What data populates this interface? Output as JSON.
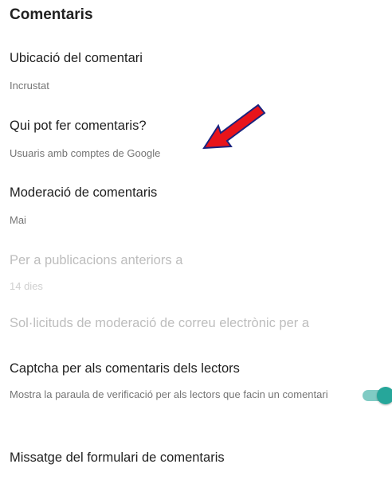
{
  "section_title": "Comentaris",
  "settings": {
    "location": {
      "title": "Ubicació del comentari",
      "value": "Incrustat"
    },
    "who_can_comment": {
      "title": "Qui pot fer comentaris?",
      "value": "Usuaris amb comptes de Google"
    },
    "moderation": {
      "title": "Moderació de comentaris",
      "value": "Mai"
    },
    "older_posts": {
      "title": "Per a publicacions anteriors a",
      "value": "14 dies"
    },
    "email_moderation": {
      "title": "Sol·licituds de moderació de correu electrònic per a"
    },
    "captcha": {
      "title": "Captcha per als comentaris dels lectors",
      "description": "Mostra la paraula de verificació per als lectors que facin un comentari",
      "enabled": true
    },
    "form_message": {
      "title": "Missatge del formulari de comentaris"
    }
  },
  "colors": {
    "accent": "#26a69a",
    "accent_track": "#80cbc4",
    "annotation_arrow": "#e8141b",
    "annotation_outline": "#1a237e"
  },
  "icons": {
    "annotation": "red-arrow-icon"
  }
}
